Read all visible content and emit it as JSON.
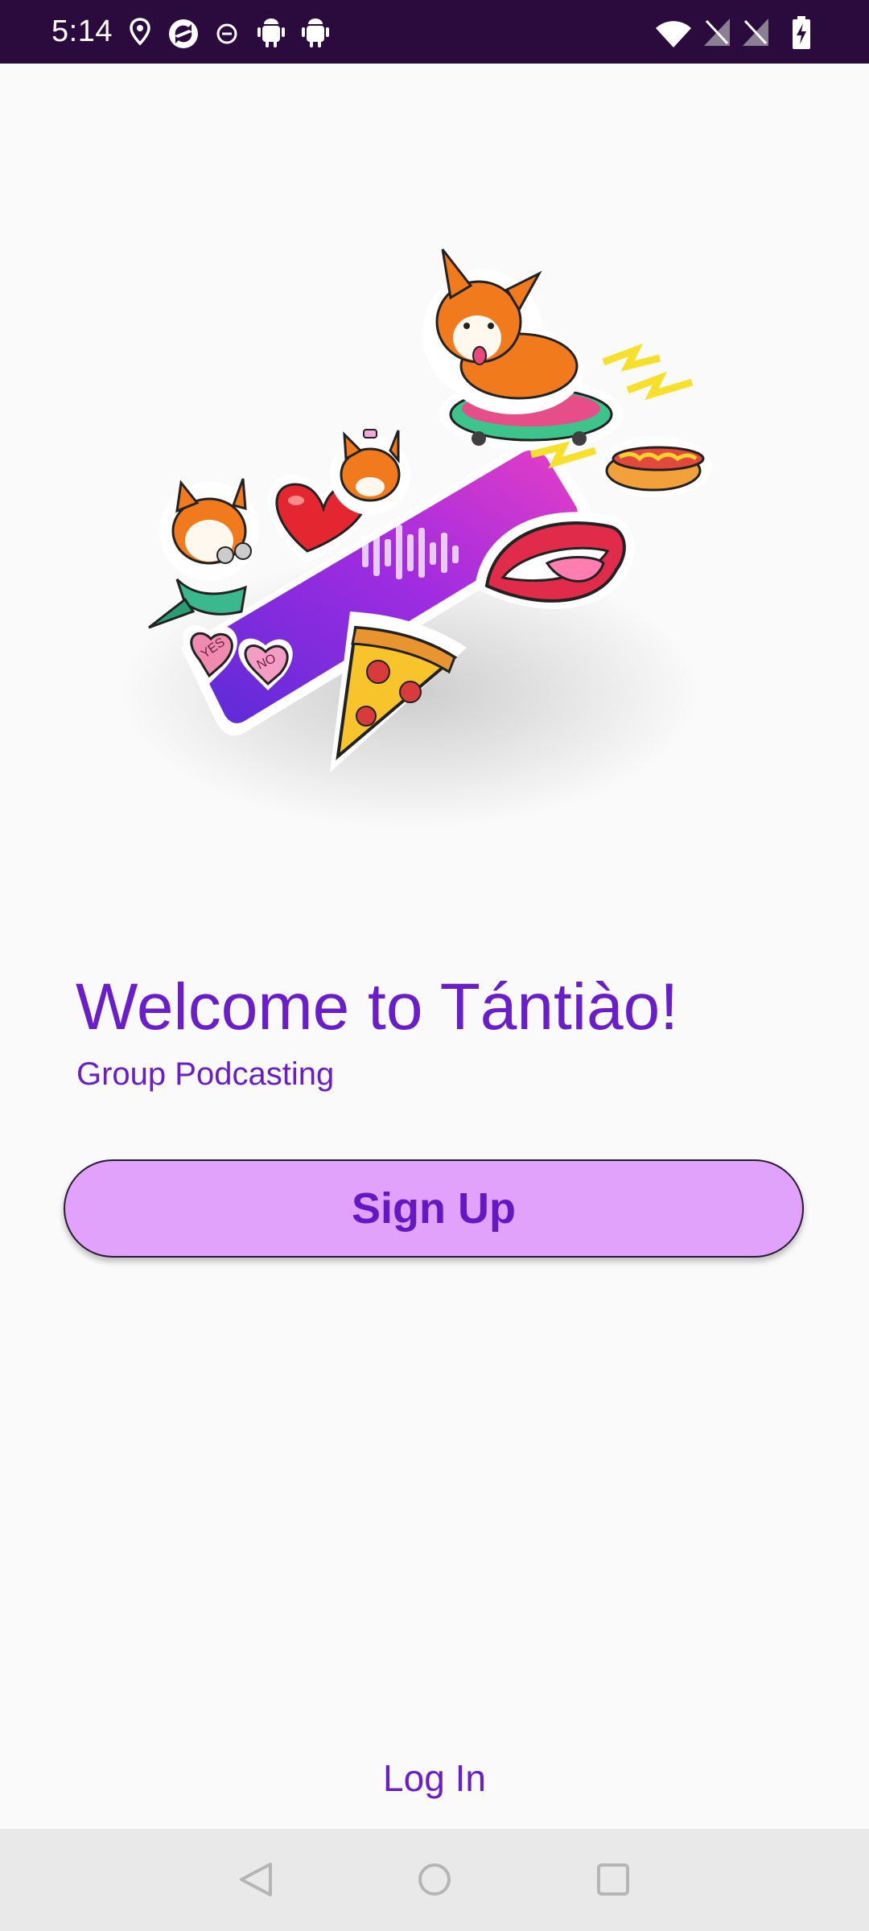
{
  "status_bar": {
    "time": "5:14",
    "left_icons": [
      "location-icon",
      "sync-icon",
      "do-not-disturb-icon",
      "android-icon",
      "android-icon"
    ],
    "right_icons": [
      "wifi-icon",
      "signal-off-icon",
      "signal-off-icon",
      "battery-charging-icon"
    ],
    "background": "#2b0a3d"
  },
  "hero": {
    "icon": "podcast-stickers-illustration"
  },
  "welcome": {
    "title": "Welcome to Tántiào!",
    "subtitle": "Group Podcasting"
  },
  "actions": {
    "signup_label": "Sign Up",
    "login_label": "Log In"
  },
  "colors": {
    "accent": "#6a1ec9",
    "button_fill": "#e0a2fb",
    "background": "#fafafa"
  },
  "nav_bar": {
    "buttons": [
      "back-icon",
      "home-icon",
      "recents-icon"
    ]
  }
}
